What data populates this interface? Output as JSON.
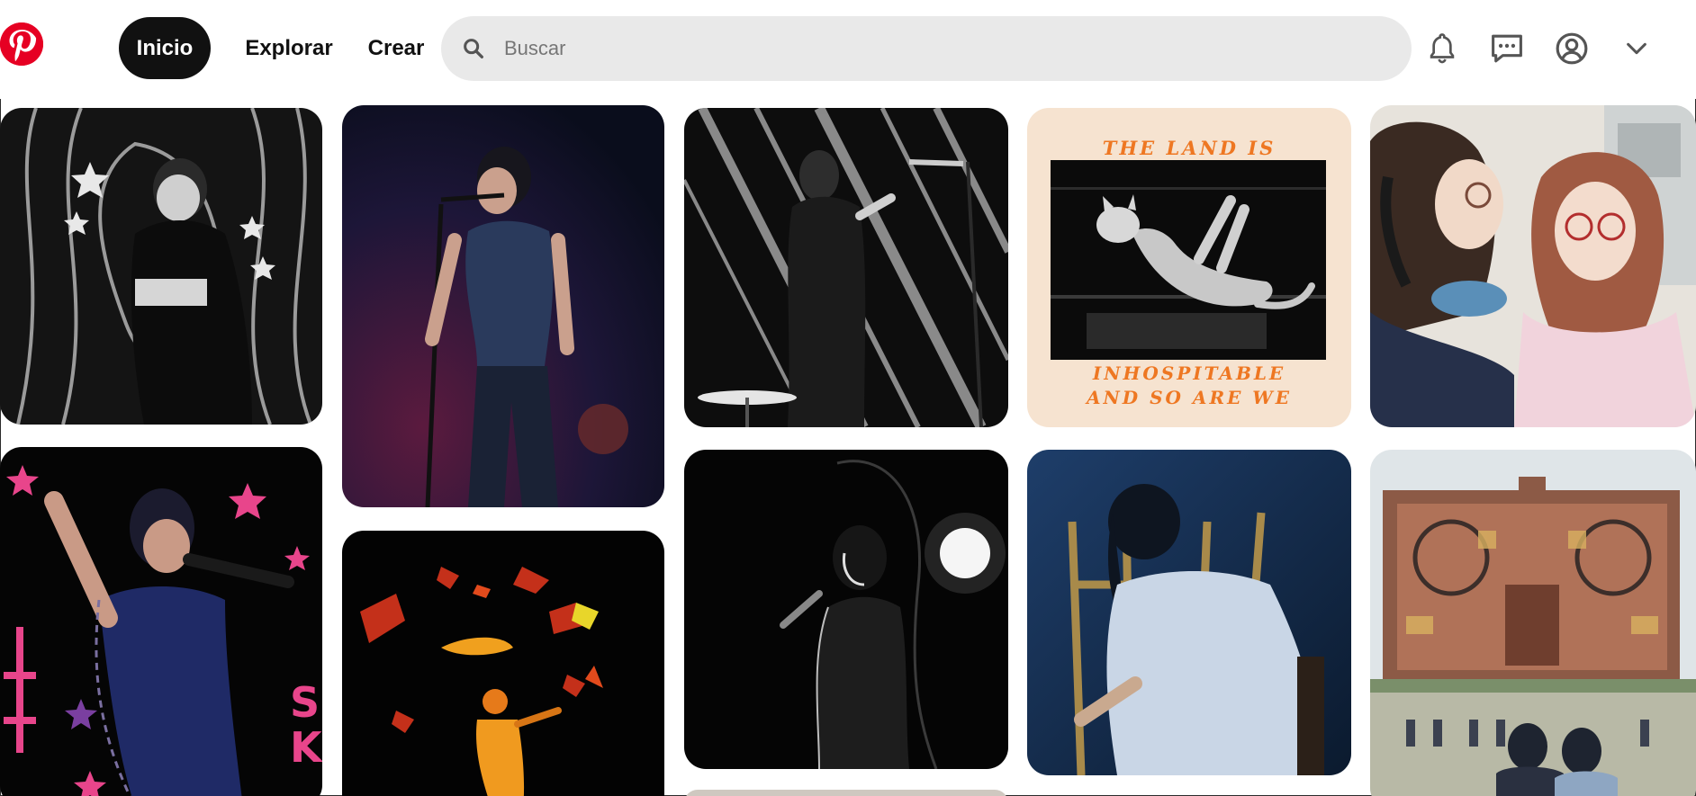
{
  "header": {
    "logo_icon": "pinterest-logo-icon",
    "nav": {
      "home_label": "Inicio",
      "explore_label": "Explorar",
      "create_label": "Crear"
    },
    "search": {
      "placeholder": "Buscar",
      "value": "",
      "icon": "search-icon"
    },
    "icons": [
      "bell-icon",
      "message-icon",
      "profile-icon",
      "chevron-down-icon"
    ]
  },
  "pins": {
    "cat_card": {
      "top_text": "THE LAND IS",
      "bottom_line1": "INHOSPITABLE",
      "bottom_line2": "AND SO ARE WE"
    }
  },
  "colors": {
    "brand_red": "#e60023",
    "active_nav_bg": "#111111",
    "search_bg": "#e9e9e9",
    "cat_card_bg": "#f6e3d0",
    "cat_card_text": "#ee7722"
  }
}
